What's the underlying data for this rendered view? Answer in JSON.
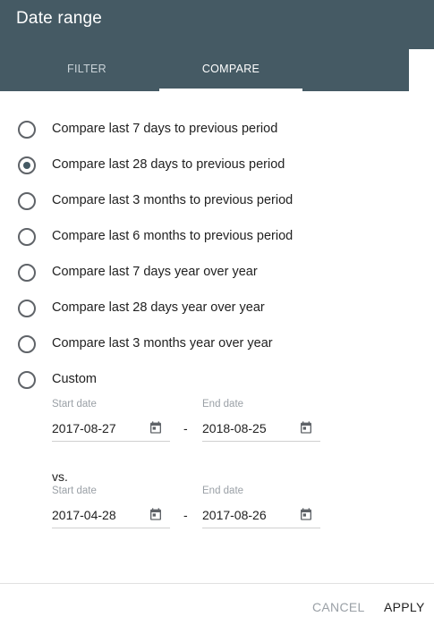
{
  "dialog": {
    "title": "Date range"
  },
  "tabs": [
    {
      "label": "FILTER",
      "active": false
    },
    {
      "label": "COMPARE",
      "active": true
    }
  ],
  "options": [
    {
      "label": "Compare last 7 days to previous period",
      "checked": false
    },
    {
      "label": "Compare last 28 days to previous period",
      "checked": true
    },
    {
      "label": "Compare last 3 months to previous period",
      "checked": false
    },
    {
      "label": "Compare last 6 months to previous period",
      "checked": false
    },
    {
      "label": "Compare last 7 days year over year",
      "checked": false
    },
    {
      "label": "Compare last 28 days year over year",
      "checked": false
    },
    {
      "label": "Compare last 3 months year over year",
      "checked": false
    },
    {
      "label": "Custom",
      "checked": false
    }
  ],
  "custom": {
    "range1": {
      "start_label": "Start date",
      "start_value": "2017-08-27",
      "end_label": "End date",
      "end_value": "2018-08-25"
    },
    "separator": "-",
    "vs_label": "vs.",
    "range2": {
      "start_label": "Start date",
      "start_value": "2017-04-28",
      "end_label": "End date",
      "end_value": "2017-08-26"
    },
    "calendar_icon": "calendar-icon"
  },
  "footer": {
    "cancel_label": "CANCEL",
    "apply_label": "APPLY"
  },
  "colors": {
    "header_bg": "#455a64",
    "radio_checked": "#455a64",
    "cancel_text": "#9aa0a6"
  }
}
